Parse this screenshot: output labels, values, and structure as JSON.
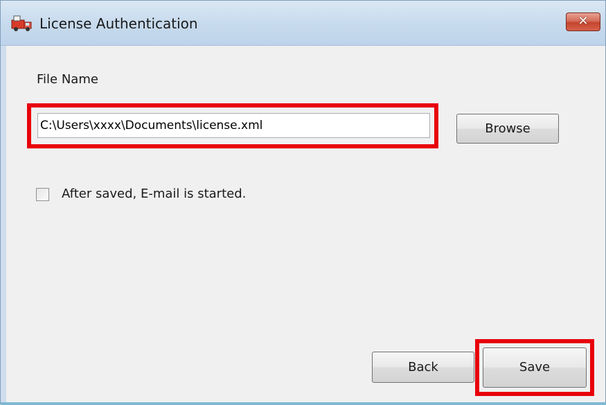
{
  "window": {
    "title": "License Authentication",
    "close_label": "✕",
    "icon": "app-truck-icon"
  },
  "form": {
    "file_label": "File Name",
    "file_value": "C:\\Users\\xxxx\\Documents\\license.xml",
    "browse_label": "Browse",
    "checkbox_label": "After saved, E-mail is started.",
    "checkbox_checked": false
  },
  "footer": {
    "back_label": "Back",
    "save_label": "Save"
  },
  "highlights": {
    "color": "#e8000a"
  }
}
